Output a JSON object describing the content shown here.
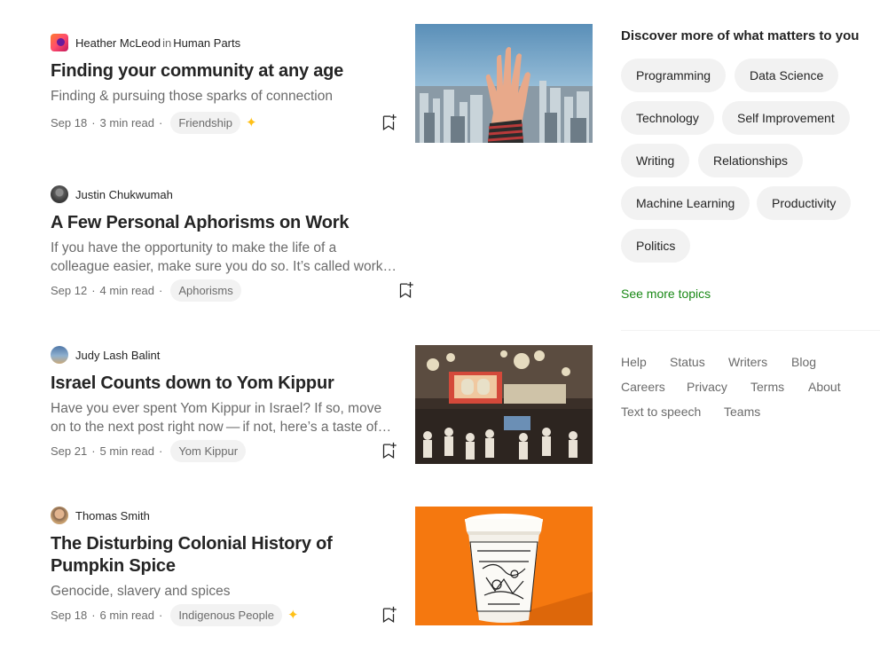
{
  "feed": {
    "articles": [
      {
        "author": "Heather McLeod",
        "in_word": "in",
        "publication": "Human Parts",
        "title": "Finding your community at any age",
        "subtitle": "Finding & pursuing those sparks of connection",
        "date": "Sep 18",
        "read_time": "3 min read",
        "tag": "Friendship",
        "member_only_icon": "sparkle-icon"
      },
      {
        "author": "Justin Chukwumah",
        "title": "A Few Personal Aphorisms on Work",
        "subtitle": "If you have the opportunity to make the life of a colleague easier, make sure you do so. It’s called work, and it’s not always easy.",
        "date": "Sep 12",
        "read_time": "4 min read",
        "tag": "Aphorisms"
      },
      {
        "author": "Judy Lash Balint",
        "title": "Israel Counts down to Yom Kippur",
        "subtitle": "Have you ever spent Yom Kippur in Israel? If so, move on to the next post right now — if not, here’s a taste of what it’s like.",
        "date": "Sep 21",
        "read_time": "5 min read",
        "tag": "Yom Kippur"
      },
      {
        "author": "Thomas Smith",
        "title": "The Disturbing Colonial History of Pumpkin Spice",
        "subtitle": "Genocide, slavery and spices",
        "date": "Sep 18",
        "read_time": "6 min read",
        "tag": "Indigenous People",
        "member_only_icon": "sparkle-icon"
      }
    ],
    "separator": "·",
    "bookmark_icon": "bookmark-add-icon"
  },
  "sidebar": {
    "title": "Discover more of what matters to you",
    "topics": [
      "Programming",
      "Data Science",
      "Technology",
      "Self Improvement",
      "Writing",
      "Relationships",
      "Machine Learning",
      "Productivity",
      "Politics"
    ],
    "see_more": "See more topics",
    "footer_links": [
      "Help",
      "Status",
      "Writers",
      "Blog",
      "Careers",
      "Privacy",
      "Terms",
      "About",
      "Text to speech",
      "Teams"
    ]
  },
  "colors": {
    "accent_green": "#1a8917",
    "member_star": "#ffc017",
    "chip_bg": "#f2f2f2",
    "text_primary": "#242424",
    "text_secondary": "#6b6b6b"
  }
}
